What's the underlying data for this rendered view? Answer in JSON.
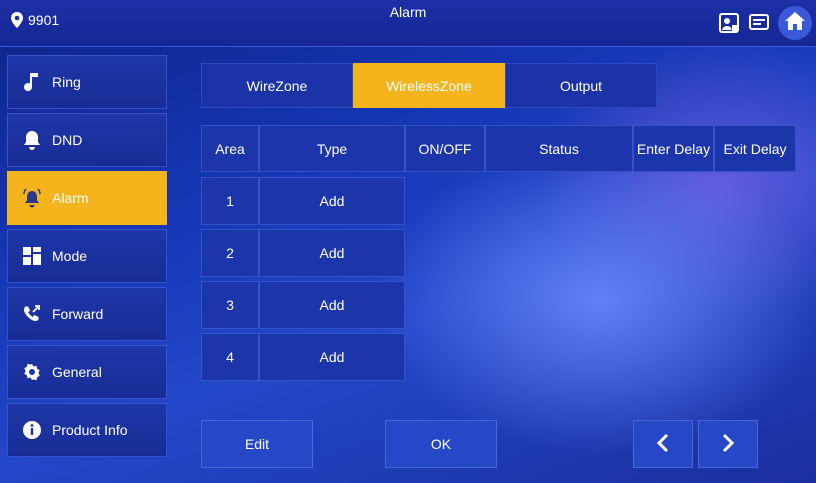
{
  "header": {
    "room": "9901",
    "title": "Alarm"
  },
  "sidebar": {
    "items": [
      {
        "label": "Ring",
        "icon": "music-note-icon"
      },
      {
        "label": "DND",
        "icon": "bell-off-icon"
      },
      {
        "label": "Alarm",
        "icon": "alarm-bell-icon",
        "active": true
      },
      {
        "label": "Mode",
        "icon": "grid-icon"
      },
      {
        "label": "Forward",
        "icon": "call-forward-icon"
      },
      {
        "label": "General",
        "icon": "gear-icon"
      },
      {
        "label": "Product Info",
        "icon": "info-icon"
      }
    ]
  },
  "tabs": [
    {
      "label": "WireZone"
    },
    {
      "label": "WirelessZone",
      "active": true
    },
    {
      "label": "Output"
    }
  ],
  "table": {
    "headers": [
      "Area",
      "Type",
      "ON/OFF",
      "Status",
      "Enter Delay",
      "Exit Delay"
    ],
    "rows": [
      {
        "area": "1",
        "type": "Add"
      },
      {
        "area": "2",
        "type": "Add"
      },
      {
        "area": "3",
        "type": "Add"
      },
      {
        "area": "4",
        "type": "Add"
      }
    ]
  },
  "buttons": {
    "edit": "Edit",
    "ok": "OK"
  },
  "colors": {
    "accent": "#f5b31c",
    "background": "#1636b5"
  }
}
